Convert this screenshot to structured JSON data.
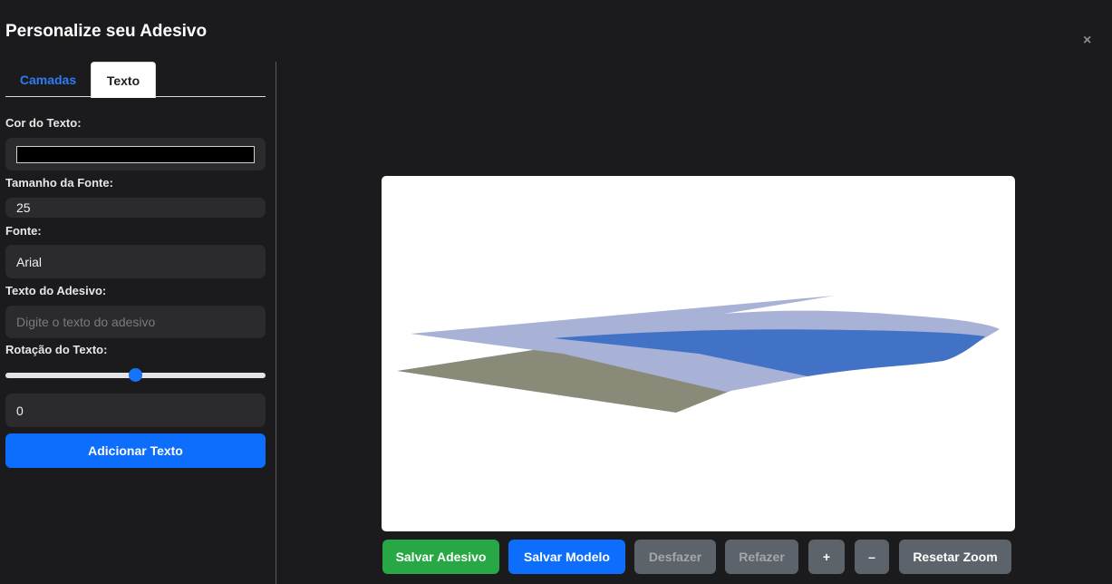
{
  "modal": {
    "title": "Personalize seu Adesivo",
    "close_symbol": "×"
  },
  "tabs": [
    {
      "label": "Camadas",
      "active": false
    },
    {
      "label": "Texto",
      "active": true
    }
  ],
  "form": {
    "text_color": {
      "label": "Cor do Texto:",
      "value": "#000000"
    },
    "font_size": {
      "label": "Tamanho da Fonte:",
      "value": "25"
    },
    "font": {
      "label": "Fonte:",
      "value": "Arial"
    },
    "sticker_text": {
      "label": "Texto do Adesivo:",
      "placeholder": "Digite o texto do adesivo",
      "value": ""
    },
    "rotation": {
      "label": "Rotação do Texto:",
      "slider_fraction": 0.5,
      "value": "0"
    },
    "add_text_button": "Adicionar Texto"
  },
  "toolbar": {
    "save_sticker": "Salvar Adesivo",
    "save_model": "Salvar Modelo",
    "undo": "Desfazer",
    "redo": "Refazer",
    "zoom_in": "+",
    "zoom_out": "–",
    "reset_zoom": "Resetar Zoom"
  },
  "colors": {
    "success": "#28a745",
    "primary": "#0d6efd",
    "secondary": "#5c636a",
    "shape_light_blue": "#a7b2d6",
    "shape_blue": "#4272c6",
    "shape_olive": "#8a8a78"
  }
}
